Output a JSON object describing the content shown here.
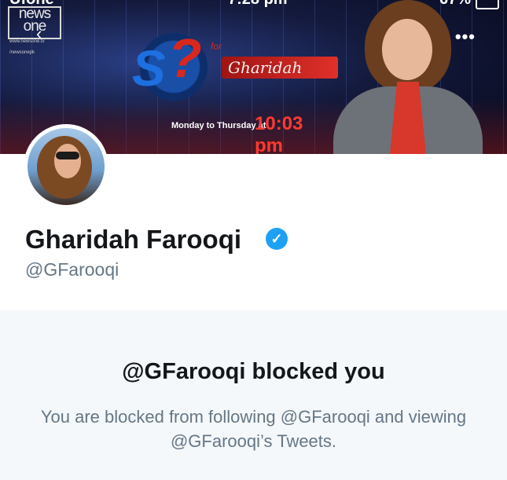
{
  "status_bar": {
    "carrier": "Ufone",
    "time": "7:28 pm",
    "battery": "67%"
  },
  "banner": {
    "channel_logo": "news one",
    "channel_site": "www.newsone.tv",
    "channel_social": "/newsonepk",
    "show_for": "for",
    "show_title": "Gharidah",
    "schedule_prefix": "Monday to Thursday at",
    "schedule_time": "10:03 pm"
  },
  "nav": {
    "back_icon": "chevron-left-icon",
    "more_icon": "more-dots-icon"
  },
  "profile": {
    "name": "Gharidah Farooqi",
    "handle": "@GFarooqi",
    "verified": true,
    "verified_color": "#1da1f2"
  },
  "blocked": {
    "title": "@GFarooqi blocked you",
    "message": "You are blocked from following @GFarooqi and viewing @GFarooqi’s Tweets."
  }
}
